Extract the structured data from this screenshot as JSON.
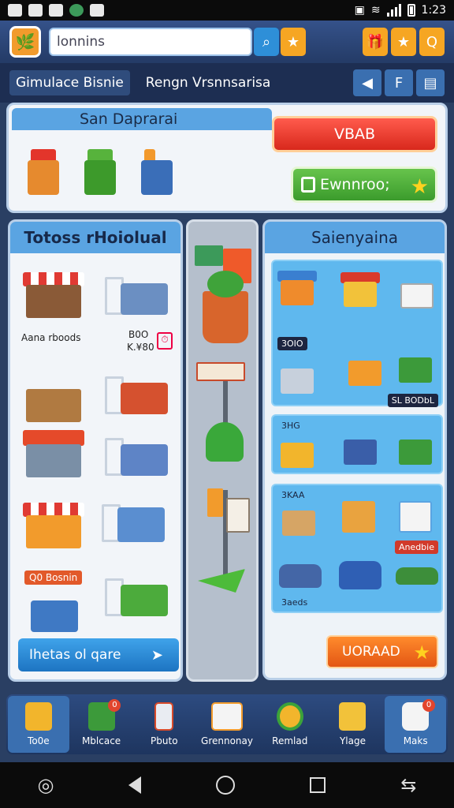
{
  "status": {
    "time": "1:23"
  },
  "topbar": {
    "search_text": "lonnins"
  },
  "subbar": {
    "tab1": "Gimulace Bisnie",
    "tab2": "Rengn Vrsnnsarisa"
  },
  "panel": {
    "title": "San Daprarai",
    "btn_red": "VBAB",
    "btn_green": "Ewnnroo;"
  },
  "left": {
    "title": "Totoss rHoiolual",
    "label1": "Aana rboods",
    "price1": "B0O",
    "price2": "K.¥80",
    "tag": "Q0 Bosnin",
    "button": "Ihetas ol qare"
  },
  "right": {
    "title": "Saienyaina",
    "tag1": "3OIO",
    "tag2": "SL BODbL",
    "tag3": "3HG",
    "tag4": "3KAA",
    "tag5": "Anedbie",
    "tag6": "3aeds",
    "button": "UORAAD"
  },
  "tabs": [
    {
      "label": "To0e",
      "badge": ""
    },
    {
      "label": "Mblcace",
      "badge": "0"
    },
    {
      "label": "Pbuto",
      "badge": ""
    },
    {
      "label": "Grennonay",
      "badge": ""
    },
    {
      "label": "Remlad",
      "badge": ""
    },
    {
      "label": "Ylage",
      "badge": ""
    },
    {
      "label": "Maks",
      "badge": "0"
    }
  ]
}
